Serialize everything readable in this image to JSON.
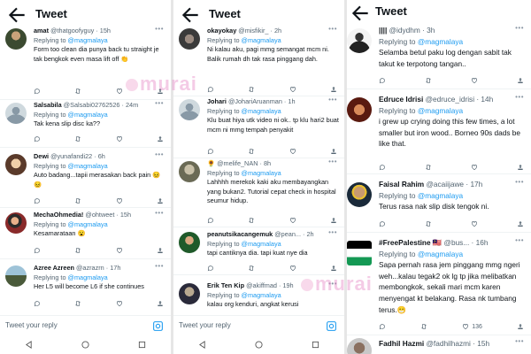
{
  "header_title": "Tweet",
  "reply_placeholder": "Tweet your reply",
  "watermark": "murai",
  "accent_color": "#1d9bf0",
  "panels": [
    {
      "tweets": [
        {
          "name": "amat",
          "handle": "@thatgoofyguy",
          "time": "15h",
          "reply_prefix": "Replying to",
          "reply_to": "@magmalaya",
          "text": "Form too clean dia punya back tu straight je tak bengkok even masa lift off 👏"
        },
        {
          "name": "Salsabila",
          "handle": "@Salsabi02762526",
          "time": "24m",
          "reply_prefix": "Replying to",
          "reply_to": "@magmalaya",
          "text": "Tak kena slip disc ka??"
        },
        {
          "name": "Dewi",
          "handle": "@yunafandi22",
          "time": "6h",
          "reply_prefix": "Replying to",
          "reply_to": "@magmalaya",
          "text": "Auto badang...tapii merasakan back pain 😣😣"
        },
        {
          "name": "MechaOhmedia!",
          "handle": "@ohtweet",
          "time": "15h",
          "reply_prefix": "Replying to",
          "reply_to": "@magmalaya",
          "text": "Kesamarataan 😮"
        },
        {
          "name": "Azree Azreen",
          "handle": "@azrazrn",
          "time": "17h",
          "reply_prefix": "Replying to",
          "reply_to": "@magmalaya",
          "text": "Her L5 will become L6 if she continues"
        }
      ]
    },
    {
      "tweets": [
        {
          "name": "okayokay",
          "handle": "@misfikir_",
          "time": "2h",
          "reply_prefix": "Replying to",
          "reply_to": "@magmalaya",
          "text": "Ni kalau aku, pagi mmg semangat mcm ni. Balik rumah dh tak rasa pinggang dah."
        },
        {
          "name": "Johari",
          "handle": "@JohariAruanman",
          "time": "1h",
          "reply_prefix": "Replying to",
          "reply_to": "@magmalaya",
          "text": "Klu buat hiya utk video ni ok.. tp klu hari2 buat mcm ni mmg tempah penyakit"
        },
        {
          "name": "🌻",
          "handle": "@melife_NAN",
          "time": "8h",
          "reply_prefix": "Replying to",
          "reply_to": "@magmalaya",
          "text": "Lahhhh merekok kaki aku membayangkan yang bukan2. Tutorial cepat check in hospital seumur hidup."
        },
        {
          "name": "peanutsikacangemuk",
          "handle": "@pean...",
          "time": "2h",
          "reply_prefix": "Replying to",
          "reply_to": "@magmalaya",
          "text": "tapi cantiknya dia. tapi kuat nye dia"
        },
        {
          "name": "Erik Ten Kip",
          "handle": "@akiffmad",
          "time": "19h",
          "reply_prefix": "Replying to",
          "reply_to": "@magmalaya",
          "text": "kalau org kenduri, angkat kerusi"
        }
      ]
    },
    {
      "tweets": [
        {
          "name": "||||",
          "handle": "@idydhm",
          "time": "3h",
          "reply_prefix": "Replying to",
          "reply_to": "@magmalaya",
          "text": "Selamba betul paku log dengan sabit tak takut ke terpotong tangan.."
        },
        {
          "name": "Edruce Idrisi",
          "handle": "@edruce_idrisi",
          "time": "14h",
          "reply_prefix": "Replying to",
          "reply_to": "@magmalaya",
          "text": "i grew up crying doing this few times, a lot smaller but iron wood.. Borneo 90s dads be like that."
        },
        {
          "name": "Faisal Rahim",
          "handle": "@acaiijawe",
          "time": "17h",
          "reply_prefix": "Replying to",
          "reply_to": "@magmalaya",
          "text": "Terus rasa nak slip disk tengok ni."
        },
        {
          "name": "#FreePalestine 🇲🇾",
          "handle": "@bus...",
          "time": "16h",
          "reply_prefix": "Replying to",
          "reply_to": "@magmalaya",
          "text": "Sapa pernah rasa jem pinggang mmg ngeri weh...kalau tegak2 ok lg tp jika melibatkan membongkok, sekali mari mcm karen menyengat kt belakang. Rasa nk tumbang terus.😁",
          "likes": "136"
        },
        {
          "name": "Fadhil Hazmi",
          "handle": "@fadhilhazmi",
          "time": "15h",
          "reply_prefix": "",
          "reply_to": "",
          "text": ""
        }
      ]
    }
  ]
}
